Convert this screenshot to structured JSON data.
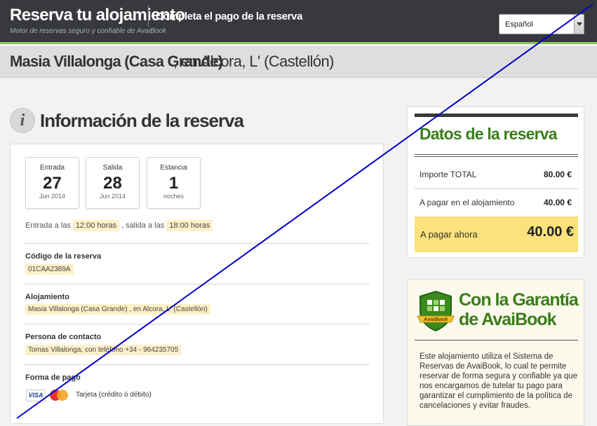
{
  "header": {
    "brand_title": "Reserva tu alojamiento",
    "brand_subtitle": "Motor de reservas seguro y confiable de AvaiBook",
    "step_title": "Completa el pago de la reserva",
    "language_selected": "Español"
  },
  "property": {
    "name": "Masia Villalonga (Casa Grande)",
    "location": ", en Alcora, L' (Castellón)"
  },
  "section": {
    "icon": "info-icon",
    "title": "Información de la reserva"
  },
  "stay": {
    "dates": [
      {
        "label": "Entrada",
        "value": "27",
        "sub": "Jun 2014"
      },
      {
        "label": "Salida",
        "value": "28",
        "sub": "Jun 2014"
      },
      {
        "label": "Estancia",
        "value": "1",
        "sub": "noches"
      }
    ],
    "times_prefix": "Entrada a las",
    "checkin_time": "12:00 horas",
    "times_middle": ", salida a las",
    "checkout_time": "18:00 horas"
  },
  "fields": [
    {
      "label": "Código de la reserva",
      "value": "01CAA2389A"
    },
    {
      "label": "Alojamiento",
      "value": "Masia Villalonga (Casa Grande) , en Alcora, L' (Castellón)"
    },
    {
      "label": "Persona de contacto",
      "value": "Tomas Villalonga, con teléfono +34 - 964235705"
    }
  ],
  "payment": {
    "label": "Forma de pago",
    "card_visa": "VISA",
    "method": "Tarjeta (crédito ó débito)"
  },
  "summary": {
    "title": "Datos de la reserva",
    "rows": [
      {
        "label": "Importe TOTAL",
        "value": "80.00 €"
      },
      {
        "label": "A pagar en el alojamiento",
        "value": "40.00 €"
      }
    ],
    "pay_now_label": "A pagar ahora",
    "pay_now_value": "40.00 €"
  },
  "guarantee": {
    "title_line1": "Con la Garantía",
    "title_line2": "de AvaiBook",
    "badge_text": "AvaiBook",
    "text": "Este alojamiento utiliza el Sistema de Reservas de AvaiBook, lo cual te permite reservar de forma segura y confiable ya que nos encargamos de tutelar tu pago para garantizar el cumplimiento de la política de cancelaciones y evitar fraudes."
  },
  "colors": {
    "header_bg": "#37393d",
    "accent_green": "#3b7c1c",
    "highlight": "#fdf0c8",
    "pay_now_bg": "#fbe27a",
    "overlay_line": "#0000cc"
  }
}
